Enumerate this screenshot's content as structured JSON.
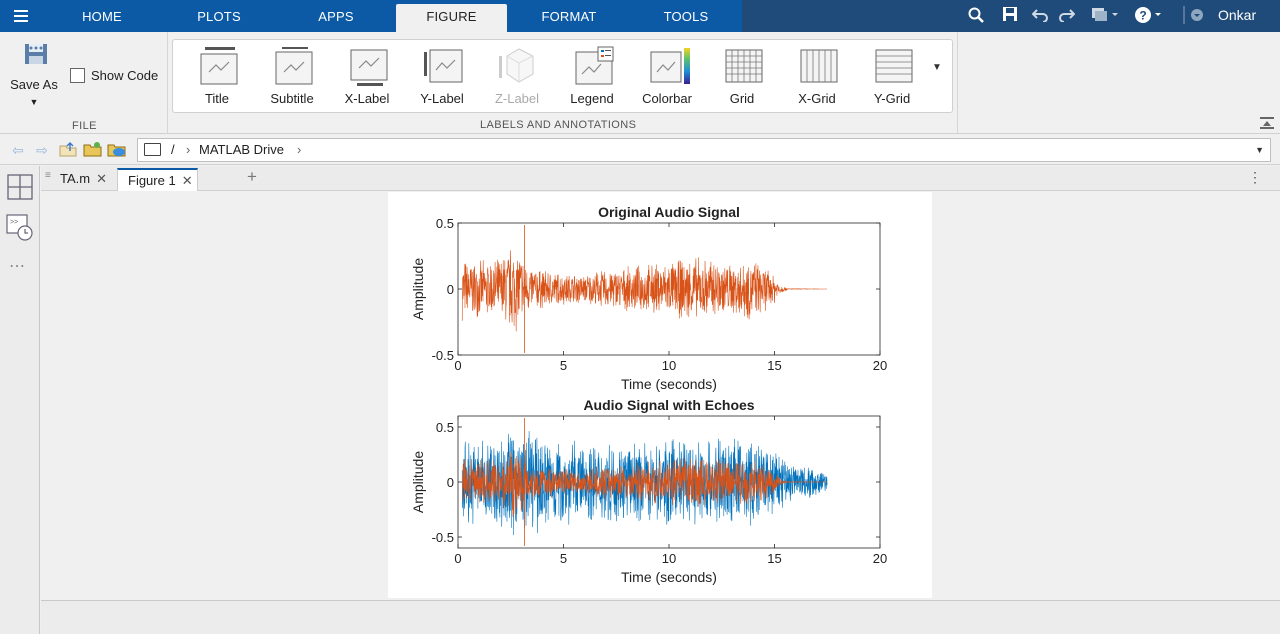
{
  "tabs": [
    {
      "label": "HOME",
      "active": false
    },
    {
      "label": "PLOTS",
      "active": false
    },
    {
      "label": "APPS",
      "active": false
    },
    {
      "label": "FIGURE",
      "active": true
    },
    {
      "label": "FORMAT",
      "active": false
    },
    {
      "label": "TOOLS",
      "active": false
    }
  ],
  "user": {
    "name": "Onkar"
  },
  "file_group": {
    "save_as_label": "Save As",
    "show_code_label": "Show Code",
    "group_label": "FILE"
  },
  "labels_group": {
    "group_label": "LABELS AND ANNOTATIONS",
    "buttons": [
      {
        "label": "Title",
        "icon": "title-icon",
        "enabled": true
      },
      {
        "label": "Subtitle",
        "icon": "subtitle-icon",
        "enabled": true
      },
      {
        "label": "X-Label",
        "icon": "x-label-icon",
        "enabled": true
      },
      {
        "label": "Y-Label",
        "icon": "y-label-icon",
        "enabled": true
      },
      {
        "label": "Z-Label",
        "icon": "z-label-icon",
        "enabled": false
      },
      {
        "label": "Legend",
        "icon": "legend-icon",
        "enabled": true
      },
      {
        "label": "Colorbar",
        "icon": "colorbar-icon",
        "enabled": true
      },
      {
        "label": "Grid",
        "icon": "grid-icon",
        "enabled": true
      },
      {
        "label": "X-Grid",
        "icon": "x-grid-icon",
        "enabled": true
      },
      {
        "label": "Y-Grid",
        "icon": "y-grid-icon",
        "enabled": true
      }
    ]
  },
  "address": {
    "root": "/",
    "folder": "MATLAB Drive"
  },
  "doc_tabs": [
    {
      "label": "TA.m",
      "active": false
    },
    {
      "label": "Figure 1",
      "active": true
    }
  ],
  "colors": {
    "accent": "#0c5aa6",
    "series_original": "#d95319",
    "series_echo": "#0072bd"
  },
  "chart_data": [
    {
      "type": "line",
      "title": "Original Audio Signal",
      "xlabel": "Time (seconds)",
      "ylabel": "Amplitude",
      "xlim": [
        0,
        20
      ],
      "ylim": [
        -0.5,
        0.5
      ],
      "xticks": [
        0,
        5,
        10,
        15,
        20
      ],
      "yticks": [
        -0.5,
        0,
        0.5
      ],
      "ytick_labels": [
        "-0.5",
        "0",
        "0.5"
      ],
      "grid": false,
      "series": [
        {
          "color": "#d95319",
          "envelope_x": [
            0.2,
            1.0,
            2.0,
            2.6,
            3.0,
            3.2,
            4.0,
            5.0,
            6.0,
            7.0,
            8.0,
            9.0,
            10.0,
            11.0,
            12.0,
            13.0,
            13.8,
            14.2,
            15.0,
            15.3,
            15.6,
            17.5
          ],
          "envelope_y": [
            0.25,
            0.22,
            0.25,
            0.38,
            0.3,
            0.2,
            0.16,
            0.13,
            0.12,
            0.16,
            0.17,
            0.2,
            0.22,
            0.26,
            0.25,
            0.21,
            0.26,
            0.22,
            0.12,
            0.04,
            0.004,
            0.0
          ]
        }
      ]
    },
    {
      "type": "line",
      "title": "Audio Signal with Echoes",
      "xlabel": "Time (seconds)",
      "ylabel": "Amplitude",
      "xlim": [
        0,
        20
      ],
      "ylim": [
        -0.6,
        0.6
      ],
      "xticks": [
        0,
        5,
        10,
        15,
        20
      ],
      "yticks": [
        -0.5,
        0,
        0.5
      ],
      "ytick_labels": [
        "-0.5",
        "0",
        "0.5"
      ],
      "grid": false,
      "series": [
        {
          "color": "#0072bd",
          "envelope_x": [
            0.2,
            1.0,
            2.0,
            2.6,
            3.0,
            4.0,
            5.0,
            6.0,
            7.0,
            8.0,
            9.0,
            10.0,
            11.0,
            12.0,
            13.0,
            14.0,
            15.0,
            16.0,
            17.0,
            17.5
          ],
          "envelope_y": [
            0.4,
            0.42,
            0.47,
            0.55,
            0.5,
            0.48,
            0.42,
            0.38,
            0.4,
            0.37,
            0.38,
            0.42,
            0.44,
            0.45,
            0.45,
            0.42,
            0.32,
            0.2,
            0.14,
            0.08
          ]
        },
        {
          "color": "#d95319",
          "envelope_x": [
            0.2,
            1.0,
            2.0,
            2.6,
            3.0,
            3.2,
            4.0,
            5.0,
            6.0,
            7.0,
            8.0,
            9.0,
            10.0,
            11.0,
            12.0,
            13.0,
            13.8,
            14.2,
            15.0,
            15.3,
            15.6,
            17.5
          ],
          "envelope_y": [
            0.25,
            0.22,
            0.25,
            0.38,
            0.3,
            0.2,
            0.16,
            0.13,
            0.12,
            0.16,
            0.17,
            0.2,
            0.22,
            0.26,
            0.25,
            0.21,
            0.26,
            0.22,
            0.12,
            0.04,
            0.004,
            0.0
          ]
        }
      ]
    }
  ]
}
